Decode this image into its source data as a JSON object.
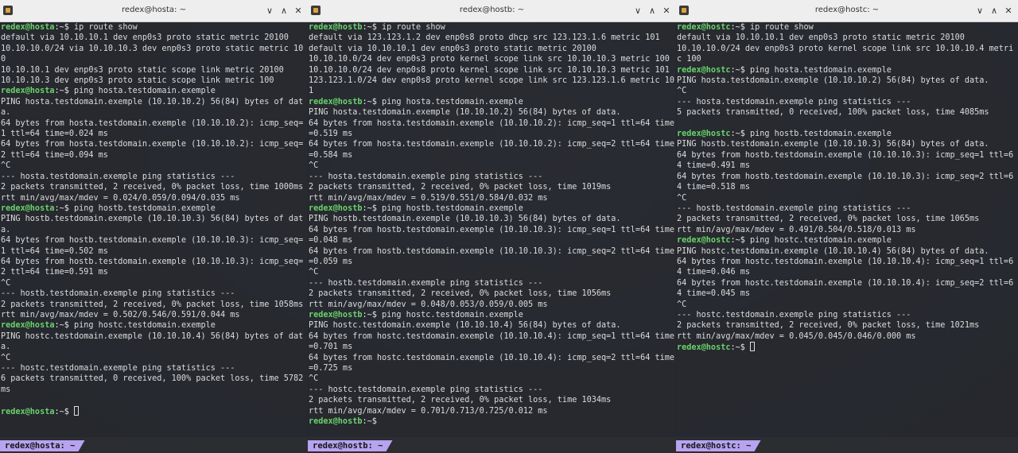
{
  "terminals": [
    {
      "title": "redex@hosta: ~",
      "status": "redex@hosta: ~",
      "lines": [
        {
          "prompt": "redex@hosta",
          "cmd": "ip route show"
        },
        {
          "text": "default via 10.10.10.1 dev enp0s3 proto static metric 20100"
        },
        {
          "text": "10.10.10.0/24 via 10.10.10.3 dev enp0s3 proto static metric 100"
        },
        {
          "text": "10.10.10.1 dev enp0s3 proto static scope link metric 20100"
        },
        {
          "text": "10.10.10.3 dev enp0s3 proto static scope link metric 100"
        },
        {
          "prompt": "redex@hosta",
          "cmd": "ping hosta.testdomain.exemple"
        },
        {
          "text": "PING hosta.testdomain.exemple (10.10.10.2) 56(84) bytes of data."
        },
        {
          "text": "64 bytes from hosta.testdomain.exemple (10.10.10.2): icmp_seq=1 ttl=64 time=0.024 ms"
        },
        {
          "text": "64 bytes from hosta.testdomain.exemple (10.10.10.2): icmp_seq=2 ttl=64 time=0.094 ms"
        },
        {
          "text": "^C"
        },
        {
          "text": "--- hosta.testdomain.exemple ping statistics ---"
        },
        {
          "text": "2 packets transmitted, 2 received, 0% packet loss, time 1000ms"
        },
        {
          "text": "rtt min/avg/max/mdev = 0.024/0.059/0.094/0.035 ms"
        },
        {
          "prompt": "redex@hosta",
          "cmd": "ping hostb.testdomain.exemple"
        },
        {
          "text": "PING hostb.testdomain.exemple (10.10.10.3) 56(84) bytes of data."
        },
        {
          "text": "64 bytes from hostb.testdomain.exemple (10.10.10.3): icmp_seq=1 ttl=64 time=0.502 ms"
        },
        {
          "text": "64 bytes from hostb.testdomain.exemple (10.10.10.3): icmp_seq=2 ttl=64 time=0.591 ms"
        },
        {
          "text": "^C"
        },
        {
          "text": "--- hostb.testdomain.exemple ping statistics ---"
        },
        {
          "text": "2 packets transmitted, 2 received, 0% packet loss, time 1058ms"
        },
        {
          "text": "rtt min/avg/max/mdev = 0.502/0.546/0.591/0.044 ms"
        },
        {
          "prompt": "redex@hosta",
          "cmd": "ping hostc.testdomain.exemple"
        },
        {
          "text": "PING hostc.testdomain.exemple (10.10.10.4) 56(84) bytes of data."
        },
        {
          "text": "^C"
        },
        {
          "text": "--- hostc.testdomain.exemple ping statistics ---"
        },
        {
          "text": "6 packets transmitted, 0 received, 100% packet loss, time 5782ms"
        },
        {
          "text": ""
        },
        {
          "prompt": "redex@hosta",
          "cmd": "",
          "cursor": true
        }
      ]
    },
    {
      "title": "redex@hostb: ~",
      "status": "redex@hostb: ~",
      "lines": [
        {
          "prompt": "redex@hostb",
          "cmd": "ip route show"
        },
        {
          "text": "default via 123.123.1.2 dev enp0s8 proto dhcp src 123.123.1.6 metric 101"
        },
        {
          "text": "default via 10.10.10.1 dev enp0s3 proto static metric 20100"
        },
        {
          "text": "10.10.10.0/24 dev enp0s3 proto kernel scope link src 10.10.10.3 metric 100"
        },
        {
          "text": "10.10.10.0/24 dev enp0s8 proto kernel scope link src 10.10.10.3 metric 101"
        },
        {
          "text": "123.123.1.0/24 dev enp0s8 proto kernel scope link src 123.123.1.6 metric 101"
        },
        {
          "prompt": "redex@hostb",
          "cmd": "ping hosta.testdomain.exemple"
        },
        {
          "text": "PING hosta.testdomain.exemple (10.10.10.2) 56(84) bytes of data."
        },
        {
          "text": "64 bytes from hosta.testdomain.exemple (10.10.10.2): icmp_seq=1 ttl=64 time=0.519 ms"
        },
        {
          "text": "64 bytes from hosta.testdomain.exemple (10.10.10.2): icmp_seq=2 ttl=64 time=0.584 ms"
        },
        {
          "text": "^C"
        },
        {
          "text": "--- hosta.testdomain.exemple ping statistics ---"
        },
        {
          "text": "2 packets transmitted, 2 received, 0% packet loss, time 1019ms"
        },
        {
          "text": "rtt min/avg/max/mdev = 0.519/0.551/0.584/0.032 ms"
        },
        {
          "prompt": "redex@hostb",
          "cmd": "ping hostb.testdomain.exemple"
        },
        {
          "text": "PING hostb.testdomain.exemple (10.10.10.3) 56(84) bytes of data."
        },
        {
          "text": "64 bytes from hostb.testdomain.exemple (10.10.10.3): icmp_seq=1 ttl=64 time=0.048 ms"
        },
        {
          "text": "64 bytes from hostb.testdomain.exemple (10.10.10.3): icmp_seq=2 ttl=64 time=0.059 ms"
        },
        {
          "text": "^C"
        },
        {
          "text": "--- hostb.testdomain.exemple ping statistics ---"
        },
        {
          "text": "2 packets transmitted, 2 received, 0% packet loss, time 1056ms"
        },
        {
          "text": "rtt min/avg/max/mdev = 0.048/0.053/0.059/0.005 ms"
        },
        {
          "prompt": "redex@hostb",
          "cmd": "ping hostc.testdomain.exemple"
        },
        {
          "text": "PING hostc.testdomain.exemple (10.10.10.4) 56(84) bytes of data."
        },
        {
          "text": "64 bytes from hostc.testdomain.exemple (10.10.10.4): icmp_seq=1 ttl=64 time=0.701 ms"
        },
        {
          "text": "64 bytes from hostc.testdomain.exemple (10.10.10.4): icmp_seq=2 ttl=64 time=0.725 ms"
        },
        {
          "text": "^C"
        },
        {
          "text": "--- hostc.testdomain.exemple ping statistics ---"
        },
        {
          "text": "2 packets transmitted, 2 received, 0% packet loss, time 1034ms"
        },
        {
          "text": "rtt min/avg/max/mdev = 0.701/0.713/0.725/0.012 ms"
        },
        {
          "prompt": "redex@hostb",
          "cmd": ""
        }
      ]
    },
    {
      "title": "redex@hostc: ~",
      "status": "redex@hostc: ~",
      "lines": [
        {
          "prompt": "redex@hostc",
          "cmd": "ip route show"
        },
        {
          "text": "default via 10.10.10.1 dev enp0s3 proto static metric 20100"
        },
        {
          "text": "10.10.10.0/24 dev enp0s3 proto kernel scope link src 10.10.10.4 metric 100"
        },
        {
          "prompt": "redex@hostc",
          "cmd": "ping hosta.testdomain.exemple"
        },
        {
          "text": "PING hosta.testdomain.exemple (10.10.10.2) 56(84) bytes of data."
        },
        {
          "text": "^C"
        },
        {
          "text": "--- hosta.testdomain.exemple ping statistics ---"
        },
        {
          "text": "5 packets transmitted, 0 received, 100% packet loss, time 4085ms"
        },
        {
          "text": ""
        },
        {
          "prompt": "redex@hostc",
          "cmd": "ping hostb.testdomain.exemple"
        },
        {
          "text": "PING hostb.testdomain.exemple (10.10.10.3) 56(84) bytes of data."
        },
        {
          "text": "64 bytes from hostb.testdomain.exemple (10.10.10.3): icmp_seq=1 ttl=64 time=0.491 ms"
        },
        {
          "text": "64 bytes from hostb.testdomain.exemple (10.10.10.3): icmp_seq=2 ttl=64 time=0.518 ms"
        },
        {
          "text": "^C"
        },
        {
          "text": "--- hostb.testdomain.exemple ping statistics ---"
        },
        {
          "text": "2 packets transmitted, 2 received, 0% packet loss, time 1065ms"
        },
        {
          "text": "rtt min/avg/max/mdev = 0.491/0.504/0.518/0.013 ms"
        },
        {
          "prompt": "redex@hostc",
          "cmd": "ping hostc.testdomain.exemple"
        },
        {
          "text": "PING hostc.testdomain.exemple (10.10.10.4) 56(84) bytes of data."
        },
        {
          "text": "64 bytes from hostc.testdomain.exemple (10.10.10.4): icmp_seq=1 ttl=64 time=0.046 ms"
        },
        {
          "text": "64 bytes from hostc.testdomain.exemple (10.10.10.4): icmp_seq=2 ttl=64 time=0.045 ms"
        },
        {
          "text": "^C"
        },
        {
          "text": "--- hostc.testdomain.exemple ping statistics ---"
        },
        {
          "text": "2 packets transmitted, 2 received, 0% packet loss, time 1021ms"
        },
        {
          "text": "rtt min/avg/max/mdev = 0.045/0.045/0.046/0.000 ms"
        },
        {
          "prompt": "redex@hostc",
          "cmd": "",
          "cursor": true
        }
      ]
    }
  ],
  "prompt_suffix": ":~$ ",
  "controls": {
    "minimize": "∨",
    "maximize": "∧",
    "close": "✕"
  },
  "colors": {
    "prompt_user": "#69d36b",
    "status_tab": "#b7a3f0",
    "titlebar": "#eeeeee"
  }
}
